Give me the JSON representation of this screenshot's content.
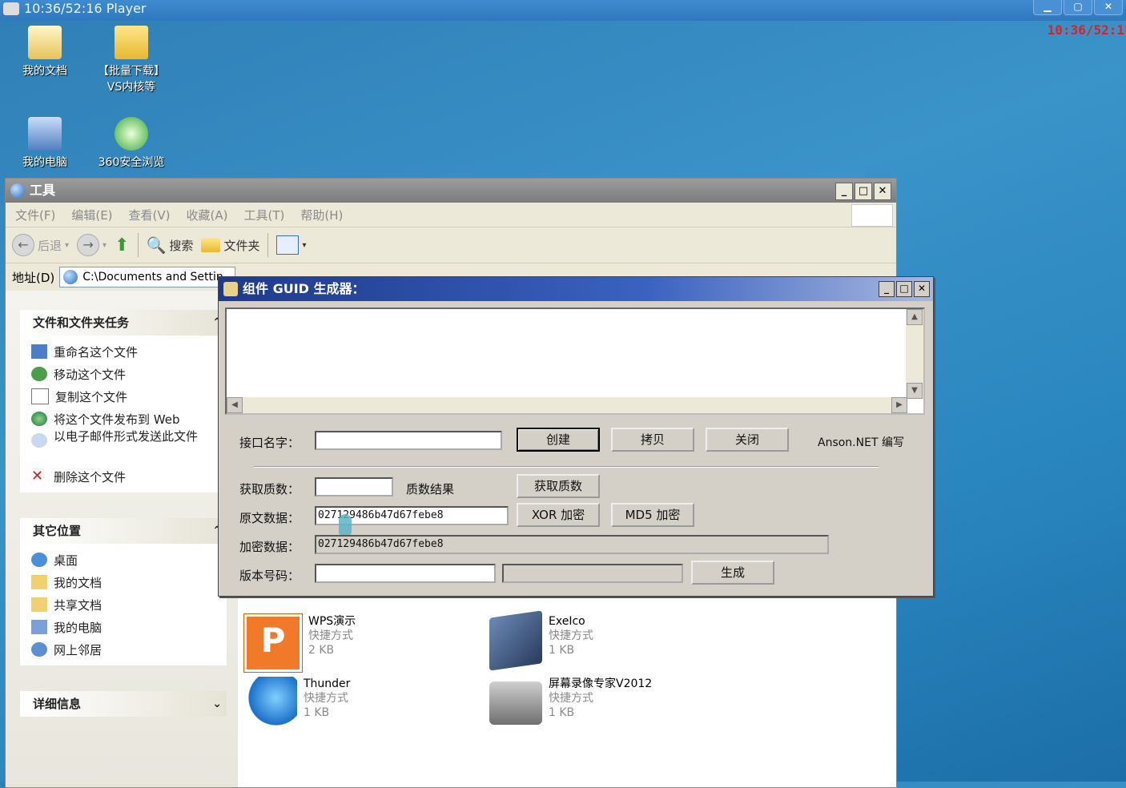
{
  "player": {
    "title": "10:36/52:16 Player",
    "buttons": [
      "▁",
      "▢",
      "✕"
    ],
    "timecode": "10:36/52:1"
  },
  "desktop": {
    "icons": [
      {
        "name": "my-documents",
        "label": "我的文档"
      },
      {
        "name": "download-folder",
        "label": "【批量下载】",
        "label2": "VS内核等"
      },
      {
        "name": "my-computer",
        "label": "我的电脑"
      },
      {
        "name": "browser-360",
        "label": "360安全浏览"
      }
    ]
  },
  "explorer": {
    "title": "工具",
    "window_buttons": [
      "_",
      "□",
      "✕"
    ],
    "menu": [
      "文件(F)",
      "编辑(E)",
      "查看(V)",
      "收藏(A)",
      "工具(T)",
      "帮助(H)"
    ],
    "toolbar": {
      "back": "后退",
      "search": "搜索",
      "folders": "文件夹"
    },
    "address_label": "地址(D)",
    "address_value": "C:\\Documents and Settin",
    "tasks_panel": {
      "title": "文件和文件夹任务",
      "items": [
        "重命名这个文件",
        "移动这个文件",
        "复制这个文件",
        "将这个文件发布到 Web",
        "以电子邮件形式发送此文件",
        "删除这个文件"
      ]
    },
    "places_panel": {
      "title": "其它位置",
      "items": [
        "桌面",
        "我的文档",
        "共享文档",
        "我的电脑",
        "网上邻居"
      ]
    },
    "details_panel": {
      "title": "详细信息"
    },
    "files": [
      {
        "name": "WPS演示",
        "type": "快捷方式",
        "size": "2 KB"
      },
      {
        "name": "ExeIco",
        "type": "快捷方式",
        "size": "1 KB"
      },
      {
        "name": "Thunder",
        "type": "快捷方式",
        "size": "1 KB"
      },
      {
        "name": "屏幕录像专家V2012",
        "type": "快捷方式",
        "size": "1 KB"
      }
    ]
  },
  "dialog": {
    "title": "组件 GUID 生成器：",
    "window_buttons": [
      "_",
      "□",
      "✕"
    ],
    "interface_label": "接口名字：",
    "interface_value": "",
    "btn_create": "创建",
    "btn_copy": "拷贝",
    "btn_close": "关闭",
    "author": "Anson.NET 编写",
    "prime_label": "获取质数：",
    "prime_value": "",
    "prime_result_label": "质数结果",
    "btn_get_prime": "获取质数",
    "plain_label": "原文数据：",
    "plain_value": "027129486b47d67febe8",
    "btn_xor": "XOR 加密",
    "btn_md5": "MD5 加密",
    "cipher_label": "加密数据：",
    "cipher_value": "027129486b47d67febe8",
    "version_label": "版本号码：",
    "version_value": "",
    "btn_generate": "生成"
  }
}
